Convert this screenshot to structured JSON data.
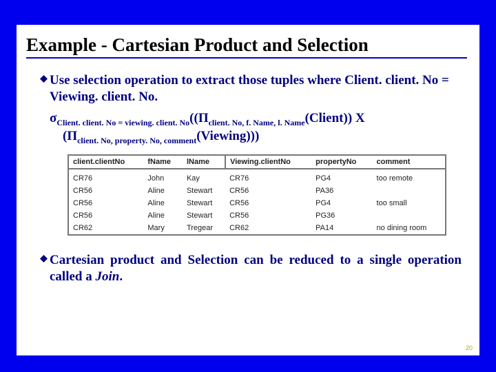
{
  "title": "Example - Cartesian Product and Selection",
  "bullet1": "Use selection operation to extract those tuples where Client. client. No = Viewing. client. No.",
  "expr": {
    "sigma": "σ",
    "sub1": "Client. client. No = viewing. client. No",
    "open1": "((",
    "pi": "Π",
    "sub2": "client. No, f. Name, l. Name",
    "rel1": "(Client))",
    "cross": " X",
    "open2": "(",
    "sub3": "client. No, property. No, comment",
    "rel2": "(Viewing)))"
  },
  "table": {
    "headers": [
      "client.clientNo",
      "fName",
      "lName",
      "Viewing.clientNo",
      "propertyNo",
      "comment"
    ],
    "rows": [
      [
        "CR76",
        "John",
        "Kay",
        "CR76",
        "PG4",
        "too remote"
      ],
      [
        "CR56",
        "Aline",
        "Stewart",
        "CR56",
        "PA36",
        ""
      ],
      [
        "CR56",
        "Aline",
        "Stewart",
        "CR56",
        "PG4",
        "too small"
      ],
      [
        "CR56",
        "Aline",
        "Stewart",
        "CR56",
        "PG36",
        ""
      ],
      [
        "CR62",
        "Mary",
        "Tregear",
        "CR62",
        "PA14",
        "no dining room"
      ]
    ]
  },
  "bullet2_a": "Cartesian product and Selection can be reduced to a single operation called a ",
  "bullet2_b": "Join",
  "bullet2_c": ".",
  "pagenum": "20"
}
